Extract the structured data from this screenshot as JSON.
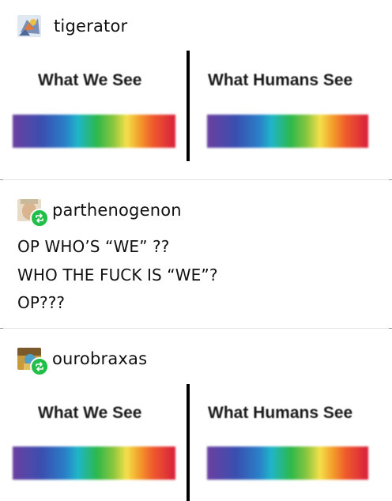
{
  "posts": [
    {
      "username": "tigerator",
      "reblog": false,
      "image": {
        "left_title": "What We See",
        "right_title": "What Humans See"
      }
    },
    {
      "username": "parthenogenon",
      "reblog": true,
      "lines": [
        "OP WHO’S “WE” ??",
        "WHO THE FUCK IS “WE”?",
        "OP???"
      ]
    },
    {
      "username": "ourobraxas",
      "reblog": true,
      "image": {
        "left_title": "What We See",
        "right_title": "What Humans See"
      }
    }
  ],
  "colors": {
    "reblog_badge": "#1fbf4a",
    "separator": "#e4e4e4"
  },
  "icons": {
    "reblog": "reblog-arrows-icon"
  }
}
